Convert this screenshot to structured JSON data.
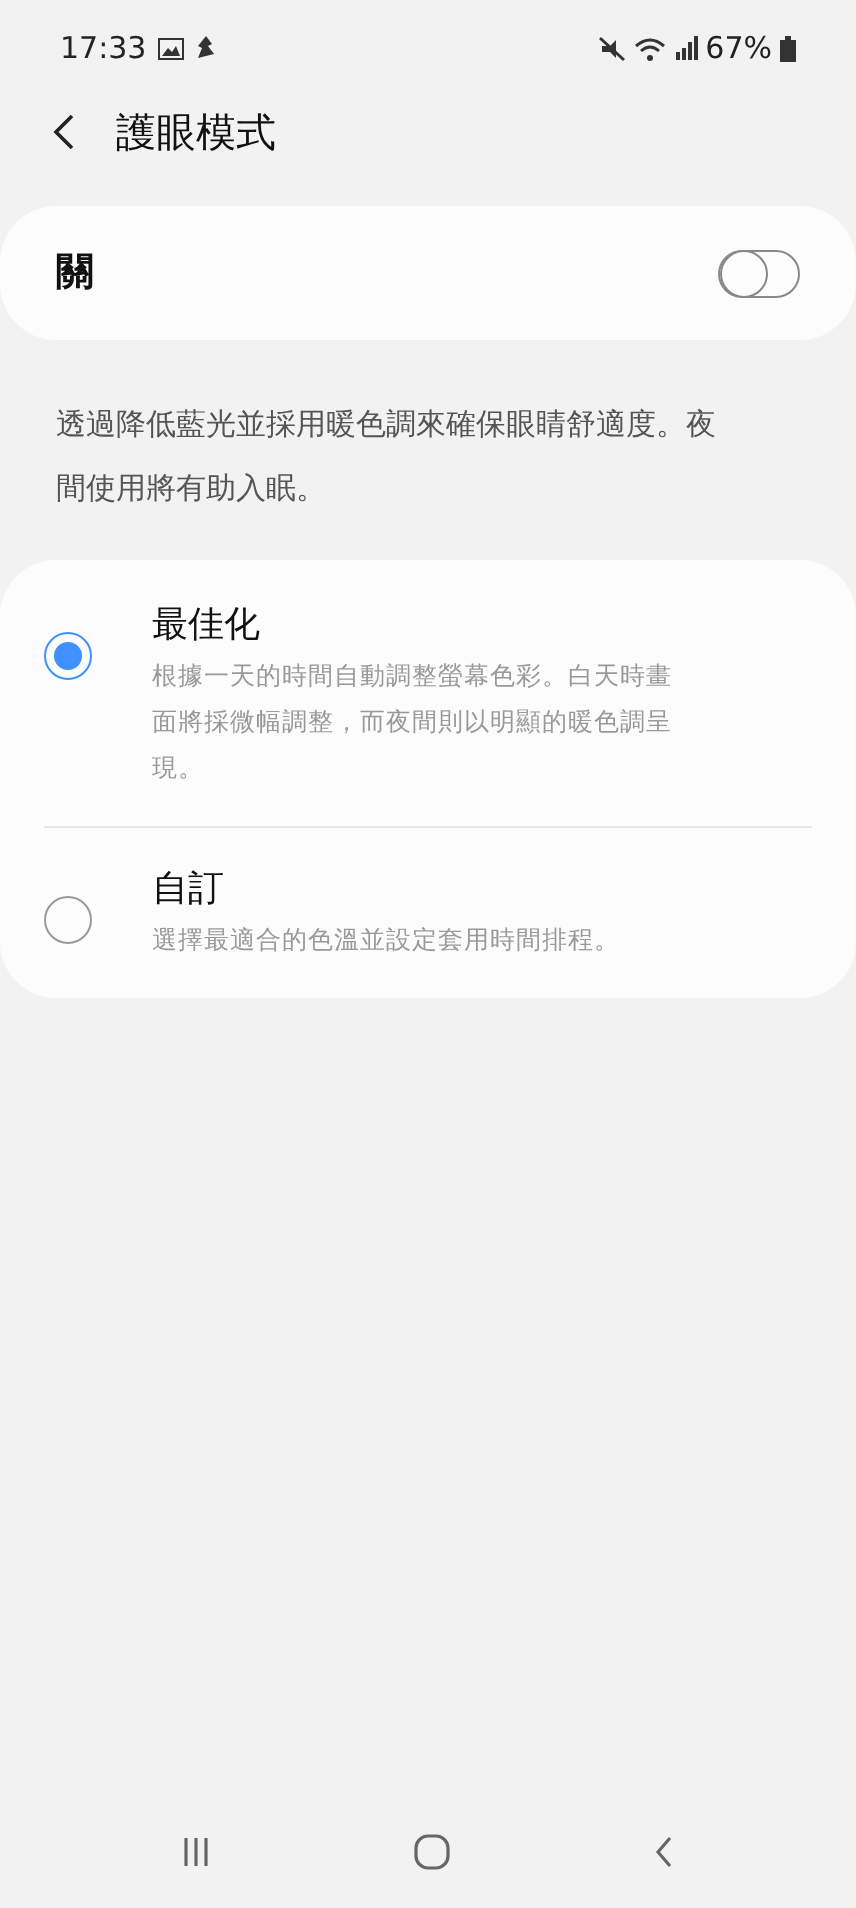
{
  "status_bar": {
    "time": "17:33",
    "battery": "67%"
  },
  "header": {
    "title": "護眼模式"
  },
  "master_switch": {
    "label": "關",
    "on": false
  },
  "description": "透過降低藍光並採用暖色調來確保眼睛舒適度。夜間使用將有助入眠。",
  "options": [
    {
      "title": "最佳化",
      "subtitle": "根據一天的時間自動調整螢幕色彩。白天時畫面將採微幅調整，而夜間則以明顯的暖色調呈現。",
      "selected": true
    },
    {
      "title": "自訂",
      "subtitle": "選擇最適合的色溫並設定套用時間排程。",
      "selected": false
    }
  ]
}
